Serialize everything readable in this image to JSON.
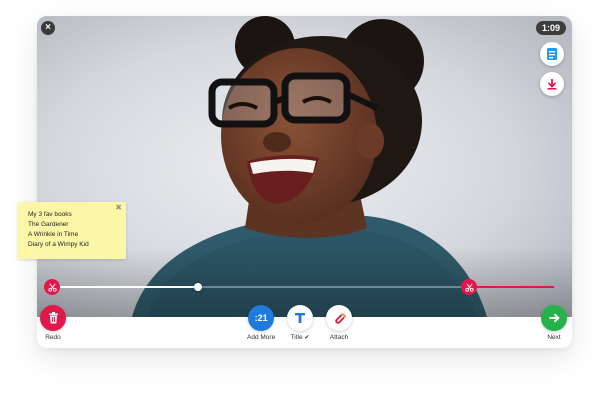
{
  "recording": {
    "timer": "1:09",
    "progress_fraction": 0.29,
    "trim_start_fraction": 0.0,
    "trim_end_fraction": 0.83
  },
  "note": {
    "lines": [
      "My 3 fav books",
      "The Gardener",
      "A Wrinkle in Time",
      "Diary of a Wimpy Kid"
    ]
  },
  "toolbar": {
    "redo_label": "Redo",
    "add_more_badge": ":21",
    "add_more_label": "Add More",
    "title_label": "Title",
    "title_check": "✔",
    "attach_label": "Attach",
    "next_label": "Next"
  },
  "icons": {
    "close": "close-icon",
    "document": "document-icon",
    "download": "download-icon",
    "scissors": "scissors-icon",
    "trash": "trash-icon",
    "title": "text-title-icon",
    "attach": "paperclip-icon",
    "next": "arrow-right-icon"
  },
  "colors": {
    "accent_red": "#e4174c",
    "accent_blue": "#1e7bdc",
    "accent_green": "#25b24a",
    "note_yellow": "#fbf7a6"
  }
}
